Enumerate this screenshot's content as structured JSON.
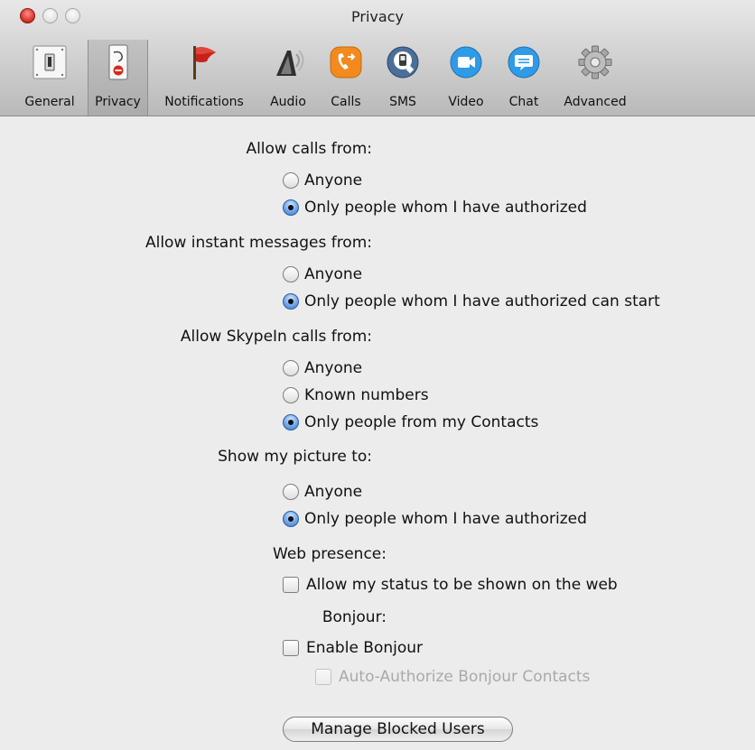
{
  "window": {
    "title": "Privacy"
  },
  "toolbar": {
    "items": [
      {
        "label": "General",
        "icon": "switch-icon"
      },
      {
        "label": "Privacy",
        "icon": "privacy-sign-icon",
        "selected": true
      },
      {
        "label": "Notifications",
        "icon": "red-flag-icon"
      },
      {
        "label": "Audio",
        "icon": "speaker-icon"
      },
      {
        "label": "Calls",
        "icon": "phone-call-icon"
      },
      {
        "label": "SMS",
        "icon": "sms-phone-icon"
      },
      {
        "label": "Video",
        "icon": "video-camera-icon"
      },
      {
        "label": "Chat",
        "icon": "chat-bubble-icon"
      },
      {
        "label": "Advanced",
        "icon": "gear-icon"
      }
    ]
  },
  "settings": {
    "calls": {
      "label": "Allow calls from:",
      "options": [
        {
          "label": "Anyone",
          "selected": false
        },
        {
          "label": "Only people whom I have authorized",
          "selected": true
        }
      ]
    },
    "messages": {
      "label": "Allow instant messages from:",
      "options": [
        {
          "label": "Anyone",
          "selected": false
        },
        {
          "label": "Only people whom I have authorized can start",
          "selected": true
        }
      ]
    },
    "skypein": {
      "label": "Allow SkypeIn calls from:",
      "options": [
        {
          "label": "Anyone",
          "selected": false
        },
        {
          "label": "Known numbers",
          "selected": false
        },
        {
          "label": "Only people from my Contacts",
          "selected": true
        }
      ]
    },
    "picture": {
      "label": "Show my picture to:",
      "options": [
        {
          "label": "Anyone",
          "selected": false
        },
        {
          "label": "Only people whom I have authorized",
          "selected": true
        }
      ]
    },
    "web_presence": {
      "label": "Web presence:",
      "checkbox_label": "Allow my status to be shown on the web",
      "checked": false
    },
    "bonjour": {
      "label": "Bonjour:",
      "enable_label": "Enable Bonjour",
      "enabled": false,
      "auto_authorize_label": "Auto-Authorize Bonjour Contacts",
      "auto_authorize_checked": false,
      "auto_authorize_disabled": true
    }
  },
  "manage_blocked_button": "Manage Blocked Users",
  "colors": {
    "radio_selected": "#3b78cc",
    "close_button": "#d12c22",
    "flag": "#c8201a",
    "calls_orange": "#f28a1e",
    "blue_icons": "#2f9be8"
  }
}
